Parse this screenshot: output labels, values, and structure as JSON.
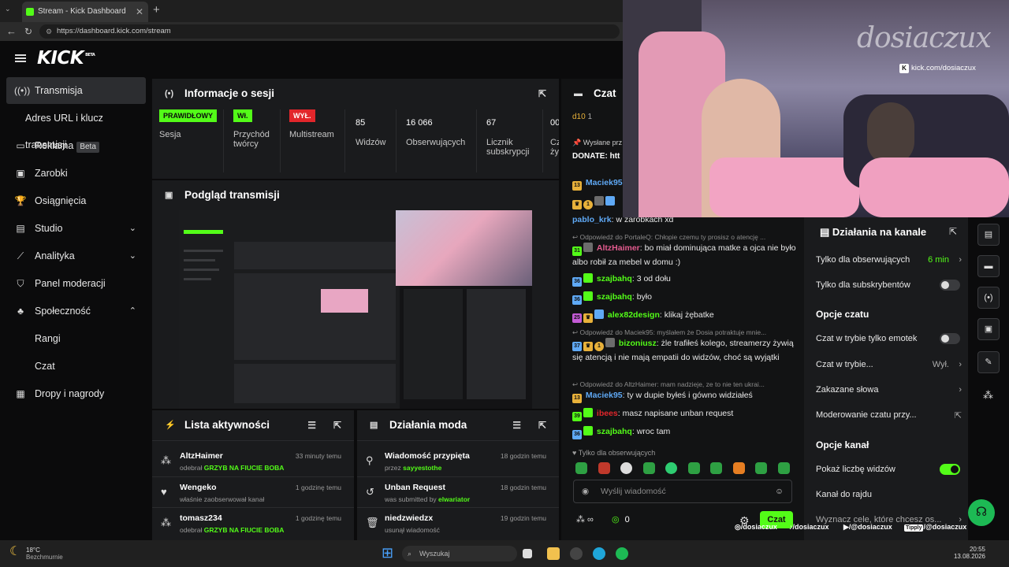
{
  "browser": {
    "tab_title": "Stream - Kick Dashboard",
    "url": "https://dashboard.kick.com/stream"
  },
  "header": {
    "logo": "KICK",
    "logo_tag": "BETA"
  },
  "sidebar": {
    "items": [
      {
        "label": "Transmisja",
        "icon": "broadcast-icon"
      },
      {
        "label": "Adres URL i klucz transmisji"
      },
      {
        "label": "Reklama",
        "badge": "Beta",
        "icon": "ad-icon"
      },
      {
        "label": "Zarobki",
        "icon": "wallet-icon"
      },
      {
        "label": "Osiągnięcia",
        "icon": "trophy-icon"
      },
      {
        "label": "Studio",
        "icon": "studio-icon"
      },
      {
        "label": "Analityka",
        "icon": "chart-icon"
      },
      {
        "label": "Panel moderacji",
        "icon": "mod-icon"
      },
      {
        "label": "Społeczność",
        "icon": "community-icon"
      },
      {
        "label": "Rangi"
      },
      {
        "label": "Czat"
      },
      {
        "label": "Dropy i nagrody",
        "icon": "gift-icon"
      }
    ]
  },
  "session": {
    "title": "Informacje o sesji",
    "stats": [
      {
        "badge": "PRAWIDŁOWY",
        "label": "Sesja"
      },
      {
        "badge": "Wł.",
        "label": "Przychód twórcy"
      },
      {
        "badge": "WYŁ.",
        "label": "Multistream"
      },
      {
        "value": "85",
        "label": "Widzów"
      },
      {
        "value": "16 066",
        "label": "Obserwujących"
      },
      {
        "value": "67",
        "label": "Licznik subskrypcji"
      },
      {
        "value": "00",
        "label": "Cz ży"
      }
    ]
  },
  "preview": {
    "title": "Podgląd transmisji"
  },
  "activity": {
    "title": "Lista aktywności",
    "rows": [
      {
        "name": "AltzHaimer",
        "time": "33 minuty temu",
        "prefix": "odebrał",
        "item": "GRZYB NA FIUCIE BOBA"
      },
      {
        "name": "Wengeko",
        "time": "1 godzinę temu",
        "prefix": "właśnie zaobserwował kanał",
        "item": ""
      },
      {
        "name": "tomasz234",
        "time": "1 godzinę temu",
        "prefix": "odebrał",
        "item": "GRZYB NA FIUCIE BOBA"
      }
    ]
  },
  "modactions": {
    "title": "Działania moda",
    "rows": [
      {
        "name": "Wiadomość przypięta",
        "time": "18 godzin temu",
        "prefix": "przez",
        "item": "sayyestothe"
      },
      {
        "name": "Unban Request",
        "time": "18 godzin temu",
        "prefix": "was submitted by",
        "item": "elwariator"
      },
      {
        "name": "niedzwiedzx",
        "time": "19 godzin temu",
        "prefix": "usunął wiadomość",
        "item": ""
      }
    ]
  },
  "chat": {
    "title": "Czat",
    "top_user": "d10",
    "top_count": "1",
    "pinned_label": "Wysłane prz",
    "pinned_text": "DONATE: htt",
    "top_name": "Maciek95",
    "messages": [
      {
        "user": "pablo_krk",
        "text": ": w zarobkach xd"
      },
      {
        "reply": "Odpowiedź do PortaleQ: Chłopie czemu ty prosisz o atencję ..."
      },
      {
        "user": "AltzHaimer",
        "text": ": bo miał dominująca matke a ojca nie było albo robił za mebel w domu :)"
      },
      {
        "user": "szajbahq",
        "text": ": 3 od dołu"
      },
      {
        "user": "szajbahq",
        "text": ": było"
      },
      {
        "user": "alex82design",
        "text": ": klikaj żębatke"
      },
      {
        "reply": "Odpowiedź do Maciek95: myślałem że Dosia potraktuje mnie..."
      },
      {
        "user": "bizoniusz",
        "text": ": żle trafiłeś kolego, streamerzy żywią się atencją i nie mają empatii do widzów, choć są wyjątki"
      },
      {
        "reply": "Odpowiedź do AltzHaimer: mam nadzieje, ze to nie ten ukrai..."
      },
      {
        "user": "Maciek95",
        "text": ": ty w dupie byłeś i gówno widziałeś"
      },
      {
        "user": "ibees",
        "text": ": masz napisane unban request"
      },
      {
        "user": "szajbahq",
        "text": ": wroc tam"
      }
    ],
    "followers_only": "Tylko dla obserwujących",
    "placeholder": "Wyślij wiadomość",
    "points": "0",
    "send_label": "Czat"
  },
  "camera": {
    "watermark": "dosiaczux",
    "handle": "kick.com/dosiaczux"
  },
  "channel_actions": {
    "title": "Działania na kanale",
    "followers_only": "Tylko dla obserwujących",
    "followers_value": "6 min",
    "subs_only": "Tylko dla subskrybentów",
    "chat_options": "Opcje czatu",
    "emotes_only": "Czat w trybie tylko emotek",
    "chat_mode": "Czat w trybie...",
    "chat_mode_value": "Wył.",
    "banned_words": "Zakazane słowa",
    "moderation": "Moderowanie czatu przy...",
    "channel_options": "Opcje kanał",
    "show_viewers": "Pokaż liczbę widzów",
    "raid": "Kanał do rajdu",
    "goals": "Wyznacz cele, które chcesz os..."
  },
  "socials": [
    "/dosiaczux",
    "/dosiaczux",
    "/@dosiaczux",
    "/@dosiaczux"
  ],
  "socials_tag": "Tipply",
  "taskbar": {
    "weather_temp": "18°C",
    "weather_desc": "Bezchmurnie",
    "search": "Wyszukaj",
    "time": "20:55",
    "date": "13.08.2026"
  },
  "colors": {
    "accent": "#53fc18",
    "panel": "#1a1b1d",
    "bg": "#0b0b0c"
  }
}
